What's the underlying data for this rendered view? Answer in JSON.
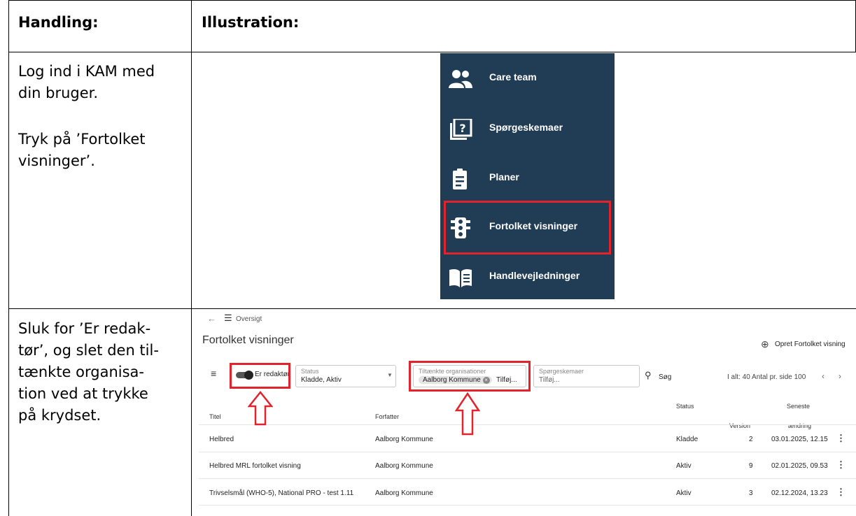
{
  "table": {
    "header_action": "Handling:",
    "header_illustration": "Illustration:",
    "row1_lines": [
      "Log ind i KAM med",
      "din bruger.",
      "Tryk på ’Fortolket",
      "visninger’."
    ],
    "row2_lines": [
      "Sluk for ’Er redak-",
      "tør’, og slet den til-",
      "tænkte organisa-",
      "tion ved at trykke",
      "på krydset."
    ]
  },
  "sidebar": {
    "items": [
      {
        "label": "Care team",
        "icon": "people-icon"
      },
      {
        "label": "Spørgeskemaer",
        "icon": "questionnaire-icon"
      },
      {
        "label": "Planer",
        "icon": "clipboard-icon"
      },
      {
        "label": "Fortolket visninger",
        "icon": "traffic-light-icon"
      },
      {
        "label": "Handlevejledninger",
        "icon": "book-icon"
      }
    ],
    "bg": "#213d55",
    "highlight": "#e3232b"
  },
  "kam": {
    "breadcrumb": "Oversigt",
    "title": "Fortolket visninger",
    "create_button": "Opret Fortolket visning",
    "toggle_label": "Er redaktør",
    "status_label": "Status",
    "status_value": "Kladde, Aktiv",
    "org_label": "Tiltænkte organisationer",
    "org_chip": "Aalborg Kommune",
    "org_placeholder": "Tilføj...",
    "q_label": "Spørgeskemaer",
    "q_placeholder": "Tilføj...",
    "search_label": "Søg",
    "pagination": "I alt: 40  Antal pr. side 100",
    "columns": {
      "title": "Titel",
      "author": "Forfatter",
      "status": "Status",
      "version": "Version",
      "changed_1": "Seneste",
      "changed_2": "ændring"
    },
    "rows": [
      {
        "title": "Helbred",
        "author": "Aalborg Kommune",
        "status": "Kladde",
        "version": "2",
        "date": "03.01.2025, 12.15"
      },
      {
        "title": "Helbred MRL fortolket visning",
        "author": "Aalborg Kommune",
        "status": "Aktiv",
        "version": "9",
        "date": "02.01.2025, 09.53"
      },
      {
        "title": "Trivselsmål (WHO-5), National PRO - test 1.11",
        "author": "Aalborg Kommune",
        "status": "Aktiv",
        "version": "3",
        "date": "02.12.2024, 13.23"
      }
    ]
  }
}
